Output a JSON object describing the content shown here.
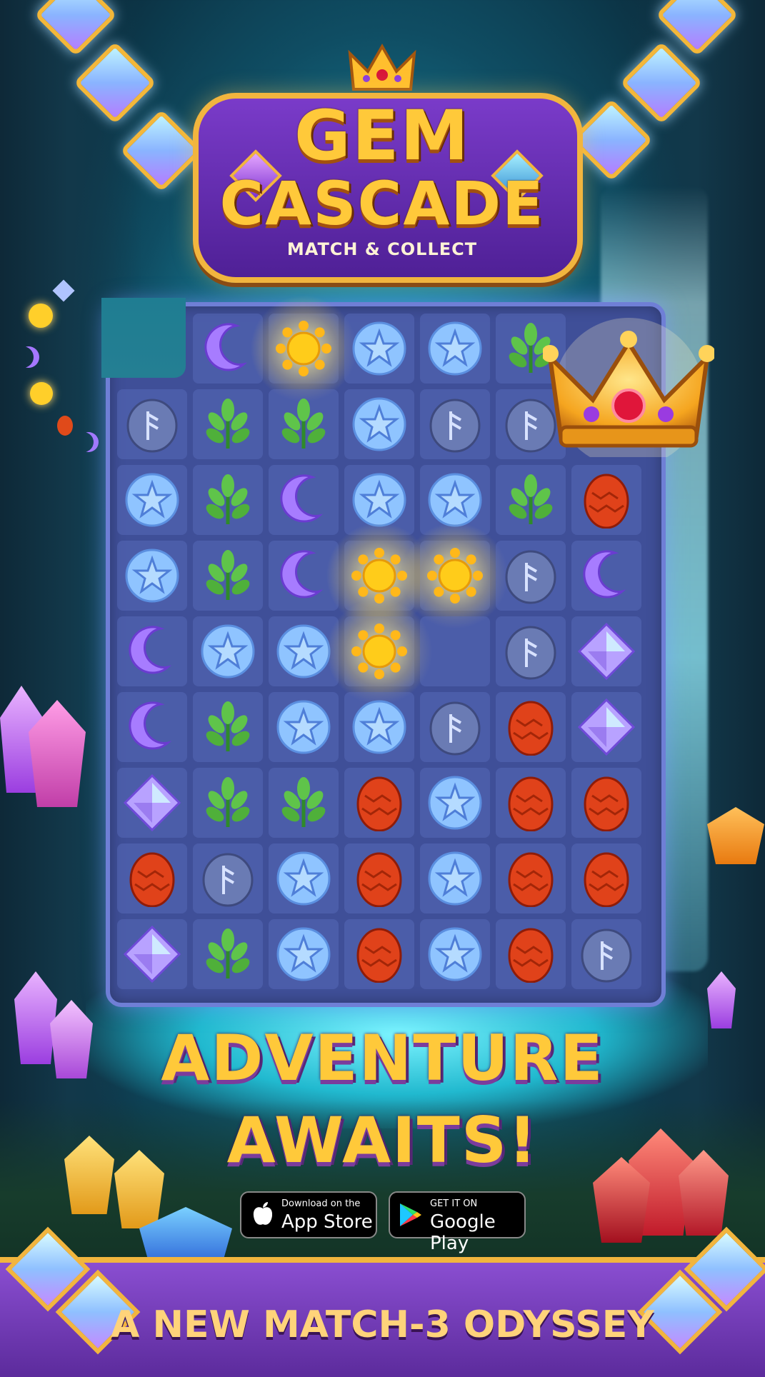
{
  "logo": {
    "line1": "GEM",
    "line2": "CASCADE",
    "subtitle": "MATCH & COLLECT"
  },
  "headline": {
    "line1": "ADVENTURE",
    "line2": "AWAITS!"
  },
  "stores": {
    "apple": {
      "small": "Download on the",
      "big": "App Store",
      "icon": "apple-icon"
    },
    "google": {
      "small": "GET IT ON",
      "big": "Google Play",
      "icon": "google-play-icon"
    }
  },
  "banner": {
    "text": "A NEW MATCH-3 ODYSSEY"
  },
  "board": {
    "rows": [
      [
        "empty",
        "moon",
        "sun",
        "star",
        "star",
        "leaf",
        "crown"
      ],
      [
        "rune",
        "leaf",
        "leaf",
        "star",
        "rune",
        "rune",
        "crown"
      ],
      [
        "star",
        "leaf",
        "moon",
        "star",
        "star",
        "leaf",
        "egg"
      ],
      [
        "star",
        "leaf",
        "moon",
        "sun",
        "sun",
        "rune",
        "moon"
      ],
      [
        "moon",
        "star",
        "star",
        "sun",
        "empty",
        "rune",
        "diamond"
      ],
      [
        "moon",
        "leaf",
        "star",
        "star",
        "rune",
        "egg",
        "diamond"
      ],
      [
        "diamond",
        "leaf",
        "leaf",
        "egg",
        "star",
        "egg",
        "egg"
      ],
      [
        "egg",
        "rune",
        "star",
        "egg",
        "star",
        "egg",
        "egg"
      ],
      [
        "diamond",
        "leaf",
        "star",
        "egg",
        "star",
        "egg",
        "rune"
      ]
    ],
    "highlighted": [
      "sun",
      "sun",
      "sun"
    ]
  },
  "colors": {
    "board_bg": "#3f4f98",
    "gold": "#ffc93a",
    "purple": "#6b33b8"
  }
}
